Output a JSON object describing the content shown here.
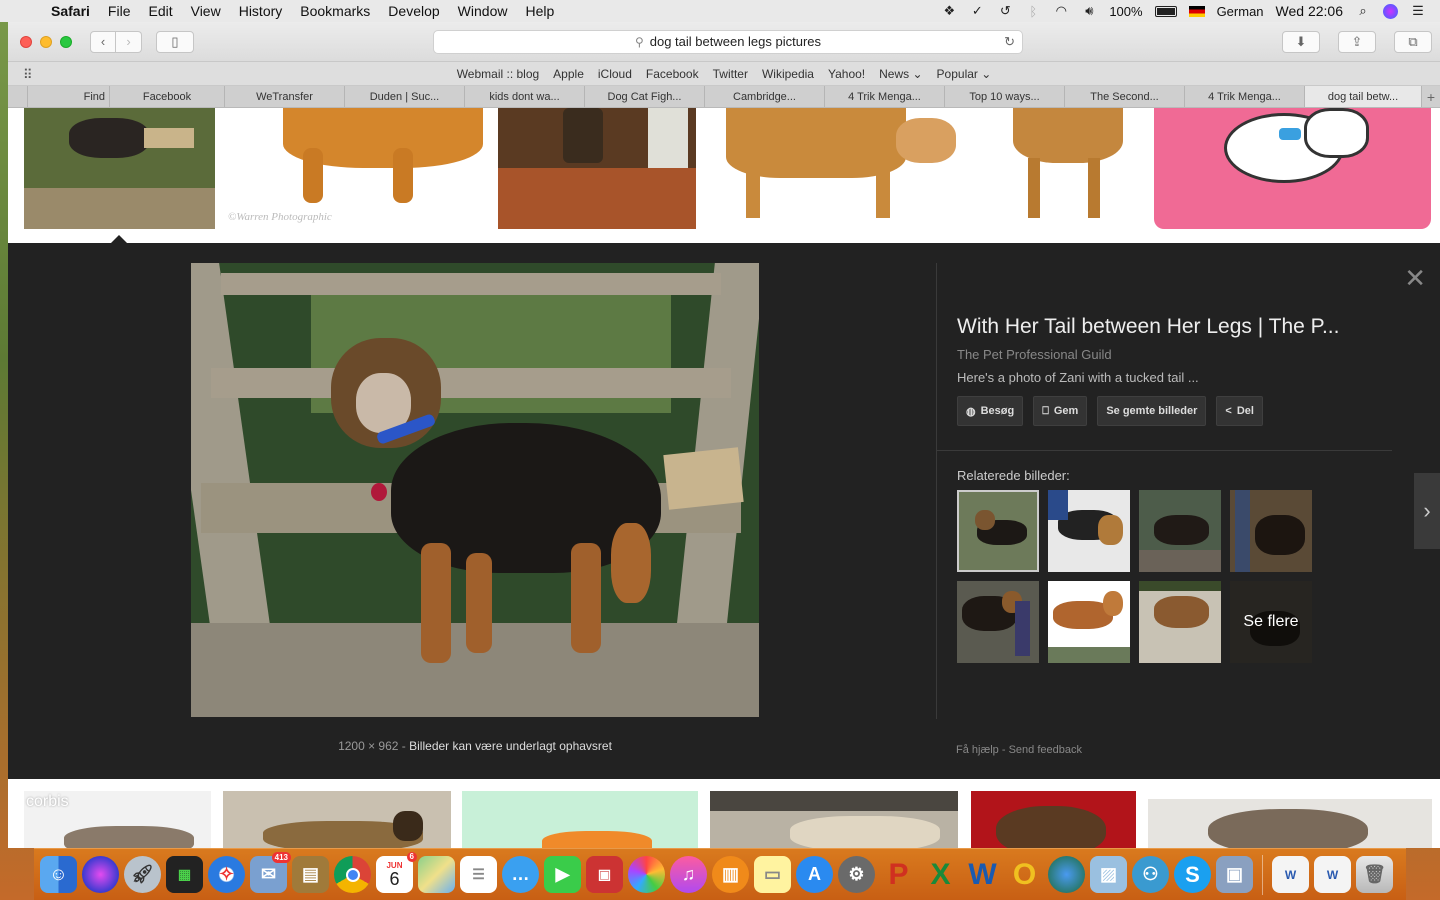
{
  "menubar": {
    "app": "Safari",
    "items": [
      "File",
      "Edit",
      "View",
      "History",
      "Bookmarks",
      "Develop",
      "Window",
      "Help"
    ],
    "battery": "100%",
    "input_source": "German",
    "clock": "Wed 22:06"
  },
  "browser": {
    "url": "dog tail between legs pictures",
    "favorites": [
      "Webmail :: blog",
      "Apple",
      "iCloud",
      "Facebook",
      "Twitter",
      "Wikipedia",
      "Yahoo!",
      "News ⌄",
      "Popular ⌄"
    ],
    "tabs": [
      "Find",
      "Facebook",
      "WeTransfer",
      "Duden | Suc...",
      "kids dont wa...",
      "Dog Cat Figh...",
      "Cambridge...",
      "4 Trik Menga...",
      "Top 10 ways...",
      "The Second...",
      "4 Trik Menga...",
      "dog tail betw..."
    ],
    "active_tab_index": 11
  },
  "preview": {
    "dimensions": "1200 × 962",
    "separator": " - ",
    "copyright": "Billeder kan være underlagt ophavsret",
    "title": "With Her Tail between Her Legs | The P...",
    "site": "The Pet Professional Guild",
    "description": "Here's a photo of Zani with a tucked tail ...",
    "buttons": {
      "visit": "Besøg",
      "save": "Gem",
      "saved": "Se gemte billeder",
      "share": "Del"
    },
    "related_label": "Relaterede billeder:",
    "see_more": "Se flere",
    "help": "Få hjælp",
    "feedback": "Send feedback",
    "link_sep": " - "
  },
  "top_thumbs": {
    "watermark": "©Warren Photographic"
  },
  "bottom_thumbs": {
    "watermark": "corbis"
  },
  "dock": {
    "mail_badge": "413",
    "calendar_badge": "6",
    "calendar_month": "JUN",
    "calendar_day": "6",
    "icons": [
      "finder-icon",
      "siri-icon",
      "launchpad-icon",
      "photo-booth-icon",
      "safari-icon",
      "mail-icon",
      "notes-app-icon",
      "chrome-icon",
      "calendar-icon",
      "maps-icon",
      "reminders-icon",
      "messages-icon",
      "facetime-icon",
      "photo-viewer-icon",
      "photos-icon",
      "itunes-icon",
      "ibooks-icon",
      "stickies-icon",
      "app-store-icon",
      "system-preferences-icon",
      "powerpoint-icon",
      "excel-icon",
      "word-icon",
      "opera-icon",
      "network-icon",
      "preview-icon",
      "contacts-icon",
      "skype-icon",
      "image-capture-icon",
      "doc-1-icon",
      "doc-2-icon",
      "trash-icon"
    ]
  }
}
